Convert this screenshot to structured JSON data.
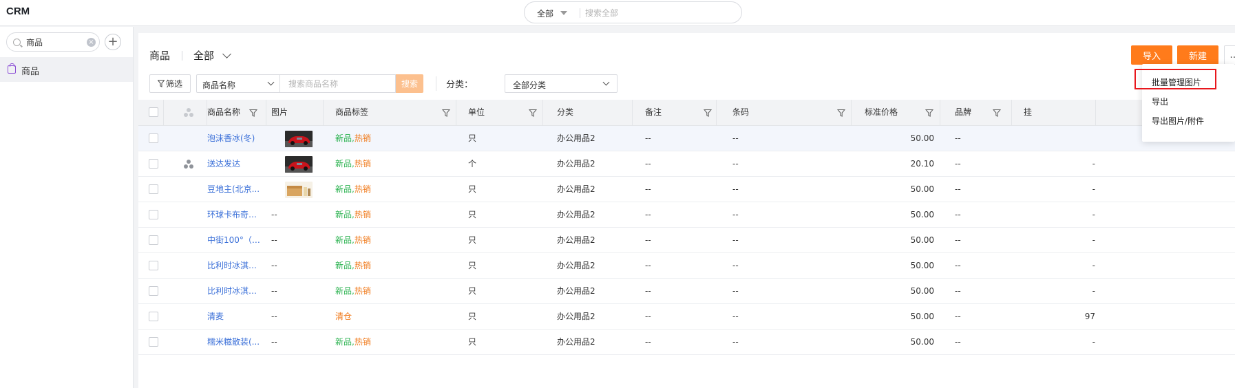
{
  "app": {
    "title": "CRM"
  },
  "global_search": {
    "scope": "全部",
    "placeholder": "搜索全部"
  },
  "sidebar": {
    "search_value": "商品",
    "items": [
      {
        "label": "商品",
        "icon": "shopping-bag-icon"
      }
    ]
  },
  "main": {
    "title": "商品",
    "view": "全部",
    "filter_label": "筛选",
    "search_field": "商品名称",
    "search_placeholder": "搜索商品名称",
    "search_button": "搜索",
    "category_label": "分类：",
    "category_value": "全部分类",
    "buttons": {
      "import": "导入",
      "new": "新建",
      "more": "..."
    }
  },
  "more_menu": {
    "items": [
      "批量管理图片",
      "导出",
      "导出图片/附件"
    ],
    "highlighted": "批量管理图片"
  },
  "table": {
    "columns": [
      "商品名称",
      "图片",
      "商品标签",
      "单位",
      "分类",
      "备注",
      "条码",
      "标准价格",
      "品牌",
      "挂"
    ],
    "rows": [
      {
        "name": "泡沫香冰(冬)",
        "image": "red-car-thumbnail",
        "tag_new": "新品,",
        "tag_hot": "热销",
        "unit": "只",
        "category": "办公用品2",
        "remark": "--",
        "barcode": "--",
        "price": "50.00",
        "brand": "--",
        "extra": "",
        "highlighted": true
      },
      {
        "name": "送达发达",
        "image": "red-car-thumbnail",
        "tag_new": "新品,",
        "tag_hot": "热销",
        "unit": "个",
        "category": "办公用品2",
        "remark": "--",
        "barcode": "--",
        "price": "20.10",
        "brand": "--",
        "extra": "-",
        "has_team_icon": true
      },
      {
        "name": "豆地主(北京...",
        "image": "gift-box-thumbnail",
        "tag_new": "新品,",
        "tag_hot": "热销",
        "unit": "只",
        "category": "办公用品2",
        "remark": "--",
        "barcode": "--",
        "price": "50.00",
        "brand": "--",
        "extra": "-"
      },
      {
        "name": "环球卡布奇诺...",
        "image": "--",
        "tag_new": "新品,",
        "tag_hot": "热销",
        "unit": "只",
        "category": "办公用品2",
        "remark": "--",
        "barcode": "--",
        "price": "50.00",
        "brand": "--",
        "extra": "-"
      },
      {
        "name": "中街100°（巧...",
        "image": "--",
        "tag_new": "新品,",
        "tag_hot": "热销",
        "unit": "只",
        "category": "办公用品2",
        "remark": "--",
        "barcode": "--",
        "price": "50.00",
        "brand": "--",
        "extra": "-"
      },
      {
        "name": "比利时冰淇淋...",
        "image": "--",
        "tag_new": "新品,",
        "tag_hot": "热销",
        "unit": "只",
        "category": "办公用品2",
        "remark": "--",
        "barcode": "--",
        "price": "50.00",
        "brand": "--",
        "extra": "-"
      },
      {
        "name": "比利时冰淇淋...",
        "image": "--",
        "tag_new": "新品,",
        "tag_hot": "热销",
        "unit": "只",
        "category": "办公用品2",
        "remark": "--",
        "barcode": "--",
        "price": "50.00",
        "brand": "--",
        "extra": "-"
      },
      {
        "name": "清麦",
        "image": "--",
        "tag_new": "",
        "tag_hot": "清仓",
        "unit": "只",
        "category": "办公用品2",
        "remark": "--",
        "barcode": "--",
        "price": "50.00",
        "brand": "--",
        "extra": "97"
      },
      {
        "name": "糯米糍散装(...",
        "image": "--",
        "tag_new": "新品,",
        "tag_hot": "热销",
        "unit": "只",
        "category": "办公用品2",
        "remark": "--",
        "barcode": "--",
        "price": "50.00",
        "brand": "--",
        "extra": "-"
      }
    ]
  },
  "colors": {
    "accent": "#ff7b1b",
    "link": "#3a6fd8",
    "tag_new": "#2ab24f",
    "tag_hot": "#f07a1b",
    "highlight_border": "#e8171d"
  }
}
